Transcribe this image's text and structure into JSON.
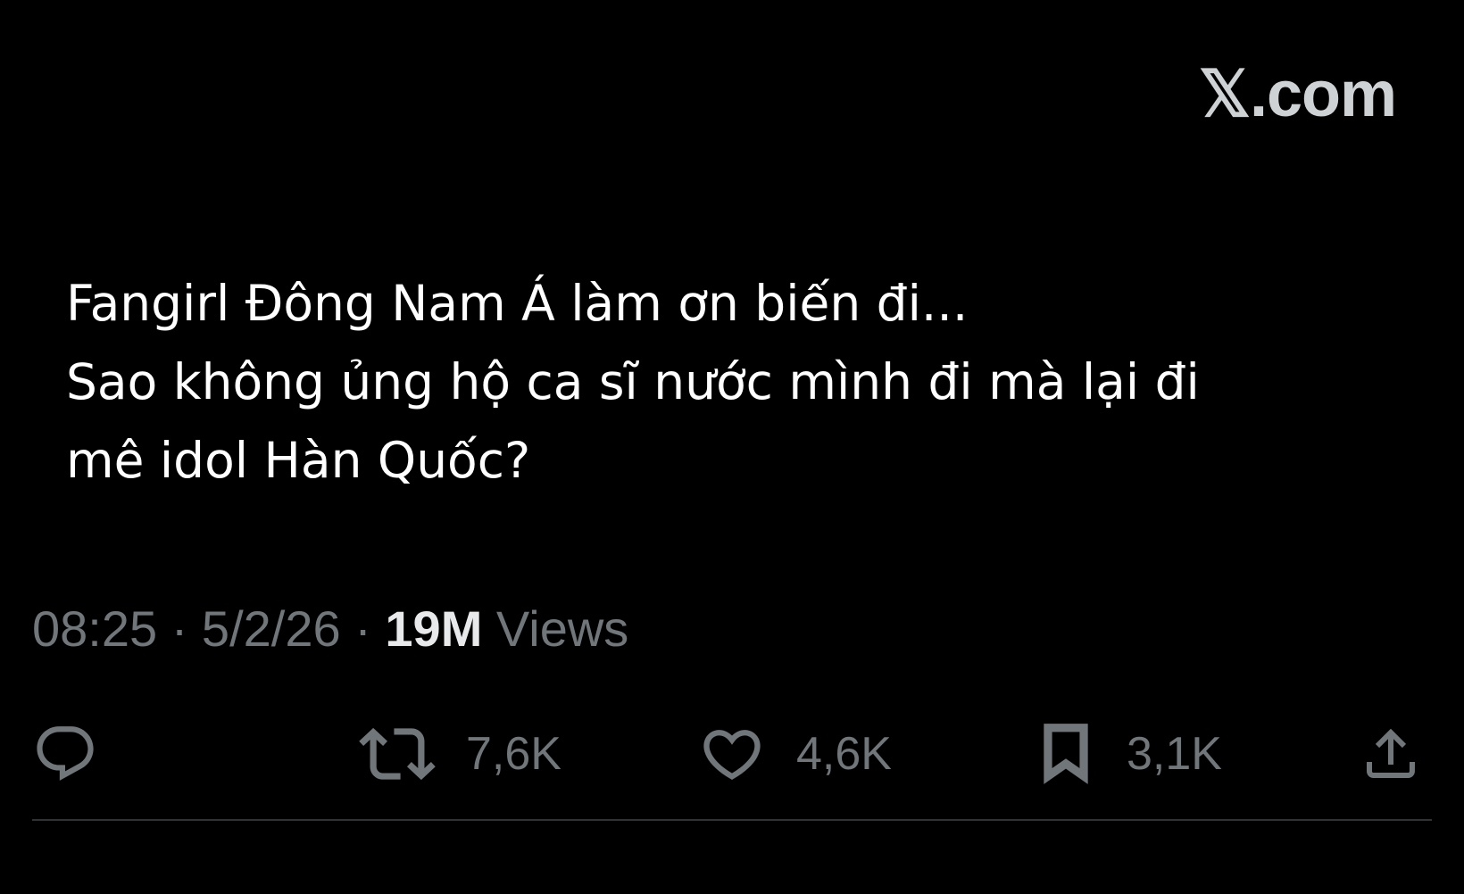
{
  "brand": {
    "label": "𝕏.com"
  },
  "tweet": {
    "lines": [
      "Fangirl Đông Nam Á làm ơn biến đi...",
      "Sao không ủng hộ ca sĩ nước mình đi mà lại đi",
      "mê idol Hàn Quốc?"
    ]
  },
  "meta": {
    "time": "08:25",
    "separator": "·",
    "date": "5/2/26",
    "views_count": "19M",
    "views_label": "Views"
  },
  "actions": {
    "reply": {
      "icon": "reply-icon"
    },
    "repost": {
      "icon": "repost-icon",
      "count": "7,6K"
    },
    "like": {
      "icon": "heart-icon",
      "count": "4,6K"
    },
    "bookmark": {
      "icon": "bookmark-icon",
      "count": "3,1K"
    },
    "share": {
      "icon": "share-icon"
    }
  },
  "colors": {
    "background": "#000000",
    "text": "#ffffff",
    "secondary": "#71767b",
    "divider": "#2f3336"
  }
}
